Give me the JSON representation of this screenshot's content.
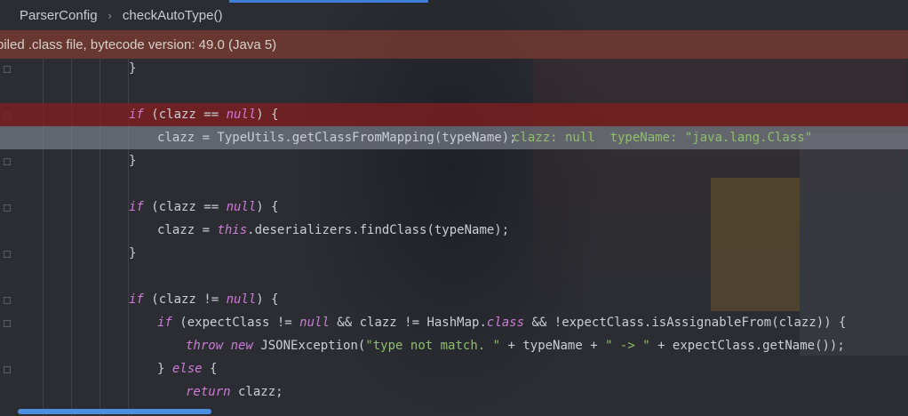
{
  "breadcrumb": {
    "class_name": "ParserConfig",
    "method_name": "checkAutoType()",
    "separator_icon": "chevron-right-icon"
  },
  "notice": {
    "text": "piled .class file, bytecode version: 49.0 (Java 5)"
  },
  "editor": {
    "lines": [
      {
        "text": "}"
      },
      {
        "text": ""
      },
      {
        "text": "if (clazz == null) {",
        "state": "breakpoint"
      },
      {
        "text": "clazz = TypeUtils.getClassFromMapping(typeName);",
        "debug": "clazz: null  typeName: \"java.lang.Class\"",
        "state": "execution"
      },
      {
        "text": "}"
      },
      {
        "text": ""
      },
      {
        "text": "if (clazz == null) {"
      },
      {
        "text": "clazz = this.deserializers.findClass(typeName);"
      },
      {
        "text": "}"
      },
      {
        "text": ""
      },
      {
        "text": "if (clazz != null) {"
      },
      {
        "text": "if (expectClass != null && clazz != HashMap.class && !expectClass.isAssignableFrom(clazz)) {"
      },
      {
        "text": "throw new JSONException(\"type not match. \" + typeName + \" -> \" + expectClass.getName());"
      },
      {
        "text": "} else {"
      },
      {
        "text": "return clazz;"
      }
    ]
  },
  "colors": {
    "keyword": "#cc7bd6",
    "string": "#8fbf6a",
    "breakpoint_line": "#801e1e",
    "execution_line": "#828892",
    "notice_banner": "#783a30",
    "accent": "#3d7fd9"
  }
}
